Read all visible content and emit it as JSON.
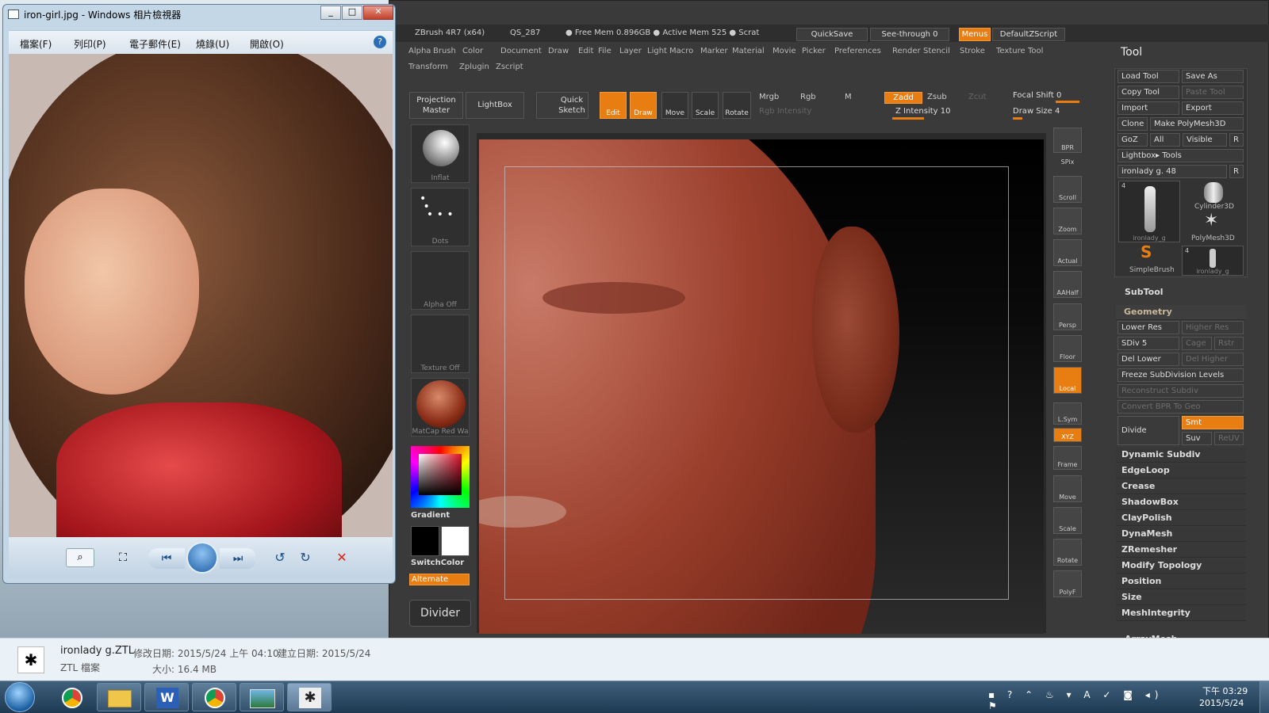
{
  "photo_viewer": {
    "title": "iron-girl.jpg - Windows 相片檢視器",
    "menus": [
      "檔案(F)",
      "列印(P)",
      "電子郵件(E)",
      "燒錄(U)",
      "開啟(O)"
    ],
    "help_label": "?"
  },
  "file_info": {
    "name": "ironlady g.ZTL",
    "type": "ZTL 檔案",
    "modified": "修改日期: 2015/5/24 上午 04:10",
    "created": "建立日期: 2015/5/24",
    "size": "大小: 16.4 MB"
  },
  "zbrush": {
    "title_items": [
      "ZBrush 4R7 (x64)",
      "QS_287",
      "● Free Mem 0.896GB ● Active Mem 525 ● Scrat"
    ],
    "quicksave": "QuickSave",
    "seethrough": "See-through  0",
    "menus_btn": "Menus",
    "script": "DefaultZScript",
    "menu_row1": [
      "Alpha",
      "Brush",
      "Color",
      "Document",
      "Draw",
      "Edit",
      "File",
      "Layer",
      "Light",
      "Macro",
      "Marker",
      "Material",
      "Movie",
      "Picker",
      "Preferences",
      "Render",
      "Stencil",
      "Stroke",
      "Texture",
      "Tool"
    ],
    "menu_row2": [
      "Transform",
      "Zplugin",
      "Zscript"
    ],
    "toolbar": {
      "projection_master": "Projection Master",
      "lightbox": "LightBox",
      "quick_sketch": "Quick Sketch",
      "edit": "Edit",
      "draw": "Draw",
      "move": "Move",
      "scale": "Scale",
      "rotate": "Rotate",
      "mrgb": "Mrgb",
      "rgb": "Rgb",
      "m": "M",
      "rgb_intensity": "Rgb Intensity",
      "zadd": "Zadd",
      "zsub": "Zsub",
      "zcut": "Zcut",
      "z_intensity": "Z Intensity 10",
      "focal_shift": "Focal Shift 0",
      "draw_size": "Draw Size 4"
    },
    "left_tools": [
      "Inflat",
      "Dots",
      "Alpha  Off",
      "Texture  Off",
      "MatCap  Red  Wa"
    ],
    "gradient": "Gradient",
    "switchcolor": "SwitchColor",
    "alternate": "Alternate",
    "divider": "Divider",
    "side_icons": [
      "BPR",
      "SPix",
      "Scroll",
      "Zoom",
      "Actual",
      "AAHalf",
      "Persp",
      "Floor",
      "Local",
      "L.Sym",
      "XYZ",
      "Frame",
      "Move",
      "Scale",
      "Rotate",
      "PolyF"
    ],
    "tool_panel": {
      "title": "Tool",
      "load_tool": "Load Tool",
      "save_as": "Save As",
      "copy_tool": "Copy Tool",
      "paste_tool": "Paste Tool",
      "import": "Import",
      "export": "Export",
      "clone": "Clone",
      "make_polymesh": "Make PolyMesh3D",
      "goz": "GoZ",
      "all": "All",
      "visible": "Visible",
      "r": "R",
      "lightbox_tools": "Lightbox▸ Tools",
      "current_tool": "ironlady g. 48",
      "thumbs": [
        "ironlady_g",
        "Cylinder3D",
        "PolyMesh3D",
        "SimpleBrush",
        "ironlady_g"
      ],
      "thumb_count_1": "4",
      "thumb_count_2": "4",
      "subtool": "SubTool",
      "geometry": "Geometry",
      "lower_res": "Lower Res",
      "higher_res": "Higher Res",
      "sdiv": "SDiv 5",
      "cage": "Cage",
      "rstr": "Rstr",
      "del_lower": "Del Lower",
      "del_higher": "Del Higher",
      "freeze": "Freeze SubDivision Levels",
      "reconstruct": "Reconstruct Subdiv",
      "convert_bpr": "Convert BPR To Geo",
      "divide": "Divide",
      "smt": "Smt",
      "suv": "Suv",
      "reuv": "ReUV",
      "sections": [
        "Dynamic Subdiv",
        "EdgeLoop",
        "Crease",
        "ShadowBox",
        "ClayPolish",
        "DynaMesh",
        "ZRemesher",
        "Modify Topology",
        "Position",
        "Size",
        "MeshIntegrity"
      ],
      "arraymesh": "ArrayMesh"
    }
  },
  "taskbar": {
    "time": "下午 03:29",
    "date": "2015/5/24"
  }
}
